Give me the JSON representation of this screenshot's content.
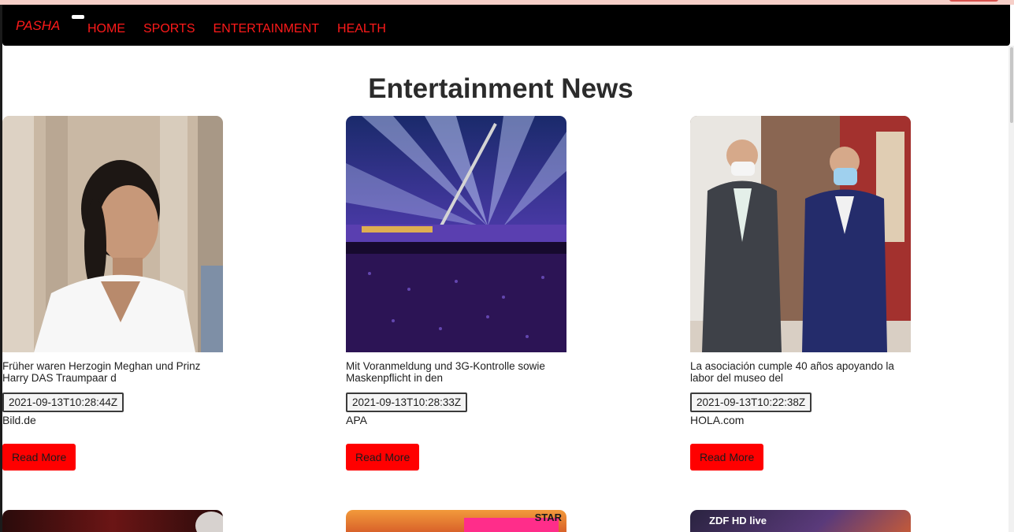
{
  "navbar": {
    "brand": "PASHA",
    "links": [
      "HOME",
      "SPORTS",
      "ENTERTAINMENT",
      "HEALTH"
    ]
  },
  "page": {
    "title": "Entertainment News"
  },
  "articles": [
    {
      "headline": "Früher waren Herzogin Meghan und Prinz Harry DAS Traumpaar d",
      "published": "2021-09-13T10:28:44Z",
      "source": "Bild.de",
      "button": "Read More"
    },
    {
      "headline": "Mit Voranmeldung und 3G-Kontrolle sowie Maskenpflicht in den",
      "published": "2021-09-13T10:28:33Z",
      "source": "APA",
      "button": "Read More"
    },
    {
      "headline": "La asociación cumple 40 años apoyando la labor del museo del",
      "published": "2021-09-13T10:22:38Z",
      "source": "HOLA.com",
      "button": "Read More"
    }
  ],
  "next_row": {
    "logo_text": "ZDF HD live",
    "star_text": "STAR"
  },
  "colors": {
    "accent": "#ff0000",
    "navbar_bg": "#000000",
    "title": "#2b2b2b"
  }
}
